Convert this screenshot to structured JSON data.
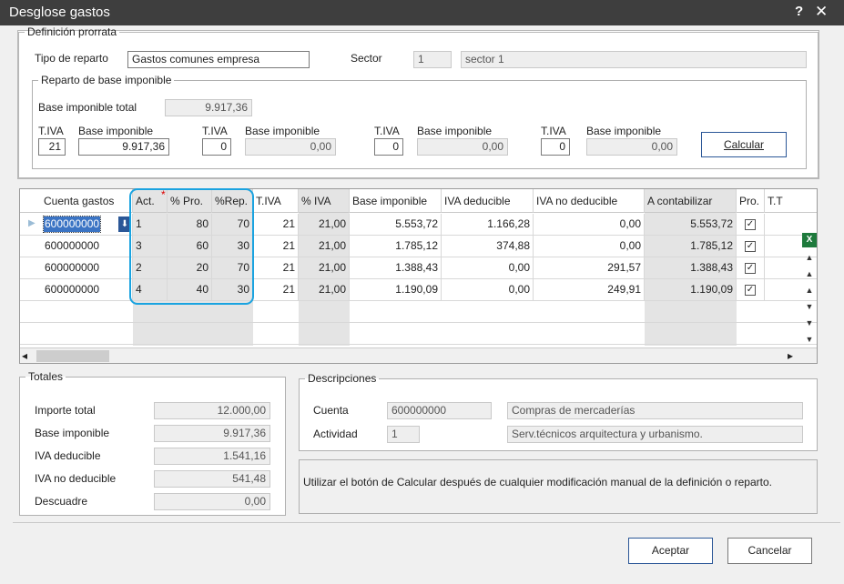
{
  "window": {
    "title": "Desglose gastos",
    "help": "?",
    "close": "✕"
  },
  "definicion": {
    "legend": "Definición prorrata",
    "tipo_label": "Tipo de reparto",
    "tipo_value": "Gastos comunes empresa",
    "sector_label": "Sector",
    "sector_code": "1",
    "sector_name": "sector 1"
  },
  "reparto": {
    "legend": "Reparto de base imponible",
    "base_total_label": "Base imponible total",
    "base_total_value": "9.917,36",
    "tiva_label": "T.IVA",
    "base_label": "Base imponible",
    "groups": [
      {
        "tiva": "21",
        "base": "9.917,36"
      },
      {
        "tiva": "0",
        "base": "0,00"
      },
      {
        "tiva": "0",
        "base": "0,00"
      },
      {
        "tiva": "0",
        "base": "0,00"
      }
    ],
    "calcular": "Calcular"
  },
  "grid": {
    "headers": [
      "Cuenta gastos",
      "Act.",
      "% Pro.",
      "%Rep.",
      "T.IVA",
      "% IVA",
      "Base imponible",
      "IVA deducible",
      "IVA no deducible",
      "A contabilizar",
      "Pro.",
      "T.T"
    ],
    "required_mark": "*",
    "rows": [
      [
        "600000000",
        "1",
        "80",
        "70",
        "21",
        "21,00",
        "5.553,72",
        "1.166,28",
        "0,00",
        "5.553,72"
      ],
      [
        "600000000",
        "3",
        "60",
        "30",
        "21",
        "21,00",
        "1.785,12",
        "374,88",
        "0,00",
        "1.785,12"
      ],
      [
        "600000000",
        "2",
        "20",
        "70",
        "21",
        "21,00",
        "1.388,43",
        "0,00",
        "291,57",
        "1.388,43"
      ],
      [
        "600000000",
        "4",
        "40",
        "30",
        "21",
        "21,00",
        "1.190,09",
        "0,00",
        "249,91",
        "1.190,09"
      ]
    ],
    "checkmark": "✓",
    "dropdown_icon": "⬇",
    "scroll_left": "◂",
    "scroll_right": "▸"
  },
  "side_buttons": [
    "excel-icon",
    "first-icon",
    "prev-page-icon",
    "up-icon",
    "down-icon",
    "next-page-icon",
    "last-icon"
  ],
  "totales": {
    "legend": "Totales",
    "items": [
      {
        "label": "Importe total",
        "value": "12.000,00"
      },
      {
        "label": "Base imponible",
        "value": "9.917,36"
      },
      {
        "label": "IVA deducible",
        "value": "1.541,16"
      },
      {
        "label": "IVA no deducible",
        "value": "541,48"
      },
      {
        "label": "Descuadre",
        "value": "0,00"
      }
    ]
  },
  "descripciones": {
    "legend": "Descripciones",
    "cuenta_label": "Cuenta",
    "cuenta_code": "600000000",
    "cuenta_name": "Compras de mercaderías",
    "actividad_label": "Actividad",
    "actividad_code": "1",
    "actividad_name": "Serv.técnicos arquitectura y urbanismo."
  },
  "message": "Utilizar el botón de Calcular después de cualquier modificación manual de la definición o reparto.",
  "buttons": {
    "accept": "Aceptar",
    "cancel": "Cancelar"
  }
}
